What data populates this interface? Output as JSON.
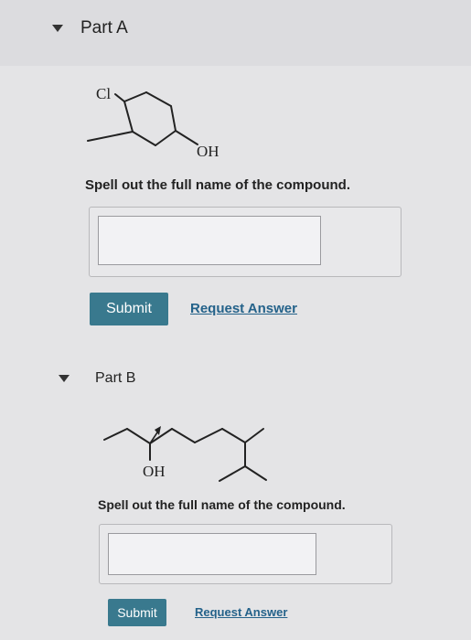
{
  "partA": {
    "title": "Part A",
    "molecule": {
      "cl_label": "Cl",
      "oh_label": "OH"
    },
    "question": "Spell out the full name of the compound.",
    "answer_value": "",
    "submit_label": "Submit",
    "request_label": "Request Answer"
  },
  "partB": {
    "title": "Part B",
    "molecule": {
      "oh_label": "OH"
    },
    "question": "Spell out the full name of the compound.",
    "answer_value": "",
    "submit_label": "Submit",
    "request_label": "Request Answer"
  },
  "colors": {
    "accent": "#39798e",
    "link": "#24628a",
    "background": "#e4e4e6"
  }
}
